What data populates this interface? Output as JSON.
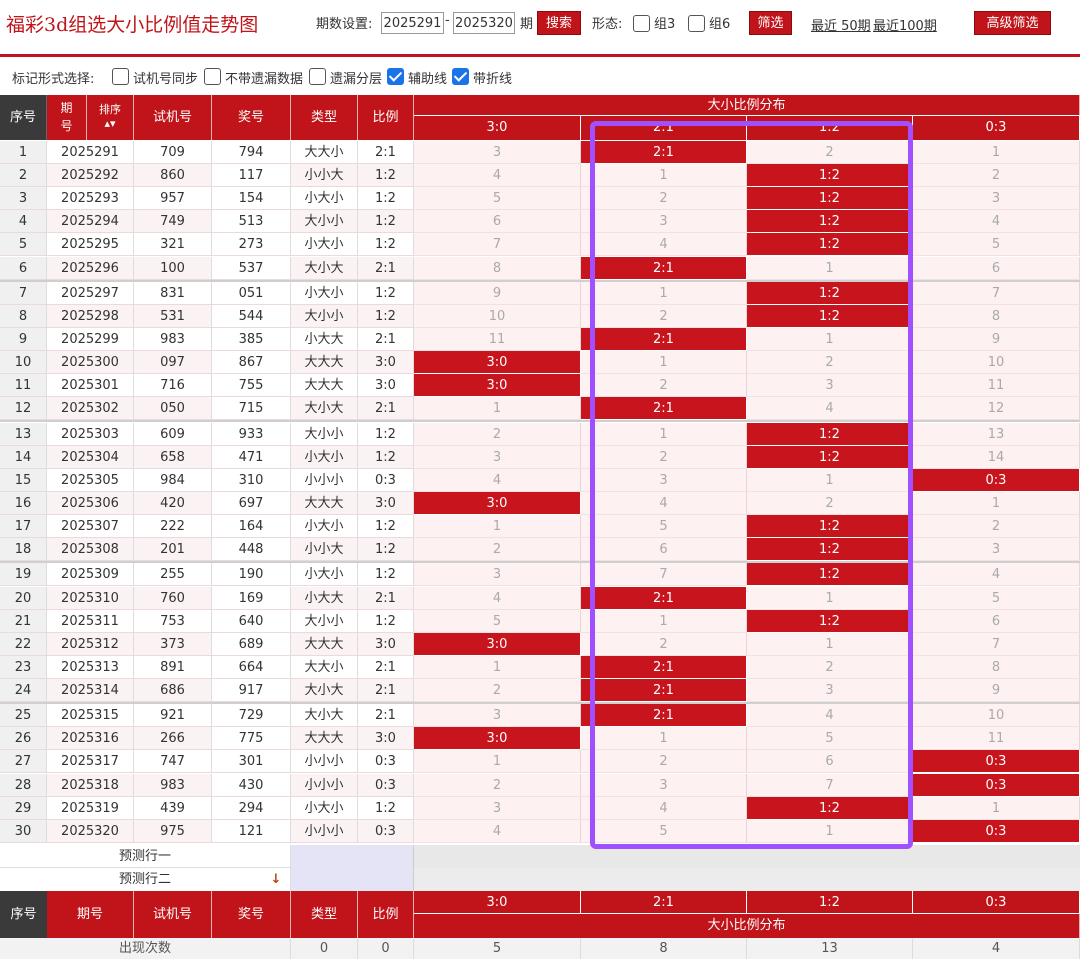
{
  "header": {
    "title": "福彩3d组选大小比例值走势图",
    "period_label": "期数设置:",
    "period_from": "2025291",
    "dash": "-",
    "period_to": "2025320",
    "period_unit": "期",
    "search_label": "搜索",
    "form_label": "形态:",
    "group3_label": "组3",
    "group6_label": "组6",
    "filter_label": "筛选",
    "recent50_label": "最近 50期",
    "recent100_label": "最近100期",
    "advanced_label": "高级筛选"
  },
  "markers": {
    "label": "标记形式选择:",
    "options": [
      {
        "label": "试机号同步",
        "checked": false
      },
      {
        "label": "不带遗漏数据",
        "checked": false
      },
      {
        "label": "遗漏分层",
        "checked": false
      },
      {
        "label": "辅助线",
        "checked": true
      },
      {
        "label": "带折线",
        "checked": true
      }
    ]
  },
  "table": {
    "headers": {
      "seq": "序号",
      "period": "期号",
      "sort": "排序",
      "trial": "试机号",
      "draw": "奖号",
      "type": "类型",
      "ratio": "比例",
      "dist": "大小比例分布",
      "cols": [
        "3:0",
        "2:1",
        "1:2",
        "0:3"
      ]
    },
    "rows": [
      {
        "seq": "1",
        "period": "2025291",
        "trial": "709",
        "draw": "794",
        "type": "大大小",
        "ratio": "2:1",
        "cells": [
          "3",
          "2:1",
          "2",
          "1"
        ]
      },
      {
        "seq": "2",
        "period": "2025292",
        "trial": "860",
        "draw": "117",
        "type": "小小大",
        "ratio": "1:2",
        "cells": [
          "4",
          "1",
          "1:2",
          "2"
        ]
      },
      {
        "seq": "3",
        "period": "2025293",
        "trial": "957",
        "draw": "154",
        "type": "小大小",
        "ratio": "1:2",
        "cells": [
          "5",
          "2",
          "1:2",
          "3"
        ]
      },
      {
        "seq": "4",
        "period": "2025294",
        "trial": "749",
        "draw": "513",
        "type": "大小小",
        "ratio": "1:2",
        "cells": [
          "6",
          "3",
          "1:2",
          "4"
        ]
      },
      {
        "seq": "5",
        "period": "2025295",
        "trial": "321",
        "draw": "273",
        "type": "小大小",
        "ratio": "1:2",
        "cells": [
          "7",
          "4",
          "1:2",
          "5"
        ]
      },
      {
        "seq": "6",
        "period": "2025296",
        "trial": "100",
        "draw": "537",
        "type": "大小大",
        "ratio": "2:1",
        "cells": [
          "8",
          "2:1",
          "1",
          "6"
        ]
      },
      {
        "seq": "7",
        "period": "2025297",
        "trial": "831",
        "draw": "051",
        "type": "小大小",
        "ratio": "1:2",
        "cells": [
          "9",
          "1",
          "1:2",
          "7"
        ]
      },
      {
        "seq": "8",
        "period": "2025298",
        "trial": "531",
        "draw": "544",
        "type": "大小小",
        "ratio": "1:2",
        "cells": [
          "10",
          "2",
          "1:2",
          "8"
        ]
      },
      {
        "seq": "9",
        "period": "2025299",
        "trial": "983",
        "draw": "385",
        "type": "小大大",
        "ratio": "2:1",
        "cells": [
          "11",
          "2:1",
          "1",
          "9"
        ]
      },
      {
        "seq": "10",
        "period": "2025300",
        "trial": "097",
        "draw": "867",
        "type": "大大大",
        "ratio": "3:0",
        "cells": [
          "3:0",
          "1",
          "2",
          "10"
        ]
      },
      {
        "seq": "11",
        "period": "2025301",
        "trial": "716",
        "draw": "755",
        "type": "大大大",
        "ratio": "3:0",
        "cells": [
          "3:0",
          "2",
          "3",
          "11"
        ]
      },
      {
        "seq": "12",
        "period": "2025302",
        "trial": "050",
        "draw": "715",
        "type": "大小大",
        "ratio": "2:1",
        "cells": [
          "1",
          "2:1",
          "4",
          "12"
        ]
      },
      {
        "seq": "13",
        "period": "2025303",
        "trial": "609",
        "draw": "933",
        "type": "大小小",
        "ratio": "1:2",
        "cells": [
          "2",
          "1",
          "1:2",
          "13"
        ]
      },
      {
        "seq": "14",
        "period": "2025304",
        "trial": "658",
        "draw": "471",
        "type": "小大小",
        "ratio": "1:2",
        "cells": [
          "3",
          "2",
          "1:2",
          "14"
        ]
      },
      {
        "seq": "15",
        "period": "2025305",
        "trial": "984",
        "draw": "310",
        "type": "小小小",
        "ratio": "0:3",
        "cells": [
          "4",
          "3",
          "1",
          "0:3"
        ]
      },
      {
        "seq": "16",
        "period": "2025306",
        "trial": "420",
        "draw": "697",
        "type": "大大大",
        "ratio": "3:0",
        "cells": [
          "3:0",
          "4",
          "2",
          "1"
        ]
      },
      {
        "seq": "17",
        "period": "2025307",
        "trial": "222",
        "draw": "164",
        "type": "小大小",
        "ratio": "1:2",
        "cells": [
          "1",
          "5",
          "1:2",
          "2"
        ]
      },
      {
        "seq": "18",
        "period": "2025308",
        "trial": "201",
        "draw": "448",
        "type": "小小大",
        "ratio": "1:2",
        "cells": [
          "2",
          "6",
          "1:2",
          "3"
        ]
      },
      {
        "seq": "19",
        "period": "2025309",
        "trial": "255",
        "draw": "190",
        "type": "小大小",
        "ratio": "1:2",
        "cells": [
          "3",
          "7",
          "1:2",
          "4"
        ]
      },
      {
        "seq": "20",
        "period": "2025310",
        "trial": "760",
        "draw": "169",
        "type": "小大大",
        "ratio": "2:1",
        "cells": [
          "4",
          "2:1",
          "1",
          "5"
        ]
      },
      {
        "seq": "21",
        "period": "2025311",
        "trial": "753",
        "draw": "640",
        "type": "大小小",
        "ratio": "1:2",
        "cells": [
          "5",
          "1",
          "1:2",
          "6"
        ]
      },
      {
        "seq": "22",
        "period": "2025312",
        "trial": "373",
        "draw": "689",
        "type": "大大大",
        "ratio": "3:0",
        "cells": [
          "3:0",
          "2",
          "1",
          "7"
        ]
      },
      {
        "seq": "23",
        "period": "2025313",
        "trial": "891",
        "draw": "664",
        "type": "大大小",
        "ratio": "2:1",
        "cells": [
          "1",
          "2:1",
          "2",
          "8"
        ]
      },
      {
        "seq": "24",
        "period": "2025314",
        "trial": "686",
        "draw": "917",
        "type": "大小大",
        "ratio": "2:1",
        "cells": [
          "2",
          "2:1",
          "3",
          "9"
        ]
      },
      {
        "seq": "25",
        "period": "2025315",
        "trial": "921",
        "draw": "729",
        "type": "大小大",
        "ratio": "2:1",
        "cells": [
          "3",
          "2:1",
          "4",
          "10"
        ]
      },
      {
        "seq": "26",
        "period": "2025316",
        "trial": "266",
        "draw": "775",
        "type": "大大大",
        "ratio": "3:0",
        "cells": [
          "3:0",
          "1",
          "5",
          "11"
        ]
      },
      {
        "seq": "27",
        "period": "2025317",
        "trial": "747",
        "draw": "301",
        "type": "小小小",
        "ratio": "0:3",
        "cells": [
          "1",
          "2",
          "6",
          "0:3"
        ]
      },
      {
        "seq": "28",
        "period": "2025318",
        "trial": "983",
        "draw": "430",
        "type": "小小小",
        "ratio": "0:3",
        "cells": [
          "2",
          "3",
          "7",
          "0:3"
        ]
      },
      {
        "seq": "29",
        "period": "2025319",
        "trial": "439",
        "draw": "294",
        "type": "小大小",
        "ratio": "1:2",
        "cells": [
          "3",
          "4",
          "1:2",
          "1"
        ]
      },
      {
        "seq": "30",
        "period": "2025320",
        "trial": "975",
        "draw": "121",
        "type": "小小小",
        "ratio": "0:3",
        "cells": [
          "4",
          "5",
          "1",
          "0:3"
        ]
      }
    ],
    "predict1": "预测行一",
    "predict2": "预测行二",
    "footer": {
      "count_label": "出现次数",
      "type_count": "0",
      "ratio_count": "0",
      "counts": [
        "5",
        "8",
        "13",
        "4"
      ]
    }
  },
  "colors": {
    "accent": "#c0141a",
    "hit_cell": "#c8141c",
    "highlight_box": "#a050ff",
    "checkbox_on": "#1a73e8"
  }
}
